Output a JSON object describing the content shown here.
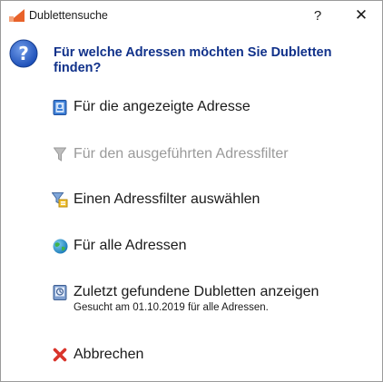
{
  "window": {
    "title": "Dublettensuche",
    "help_label": "?",
    "close_label": "✕"
  },
  "prompt": {
    "question": "Für welche Adressen möchten Sie Dubletten finden?"
  },
  "options": [
    {
      "label": "Für die angezeigte Adresse",
      "icon": "address-card-icon",
      "enabled": true
    },
    {
      "label": "Für den ausgeführten Adressfilter",
      "icon": "funnel-icon",
      "enabled": false
    },
    {
      "label": "Einen Adressfilter auswählen",
      "icon": "filter-select-icon",
      "enabled": true
    },
    {
      "label": "Für alle Adressen",
      "icon": "globe-icon",
      "enabled": true
    },
    {
      "label": "Zuletzt gefundene Dubletten anzeigen",
      "icon": "history-icon",
      "enabled": true,
      "sublabel": "Gesucht am 01.10.2019 für alle Adressen."
    },
    {
      "label": "Abbrechen",
      "icon": "cancel-x-icon",
      "enabled": true
    }
  ],
  "colors": {
    "question_text": "#10318a",
    "cancel_icon": "#d9342b",
    "disabled_text": "#9a9a9a"
  }
}
